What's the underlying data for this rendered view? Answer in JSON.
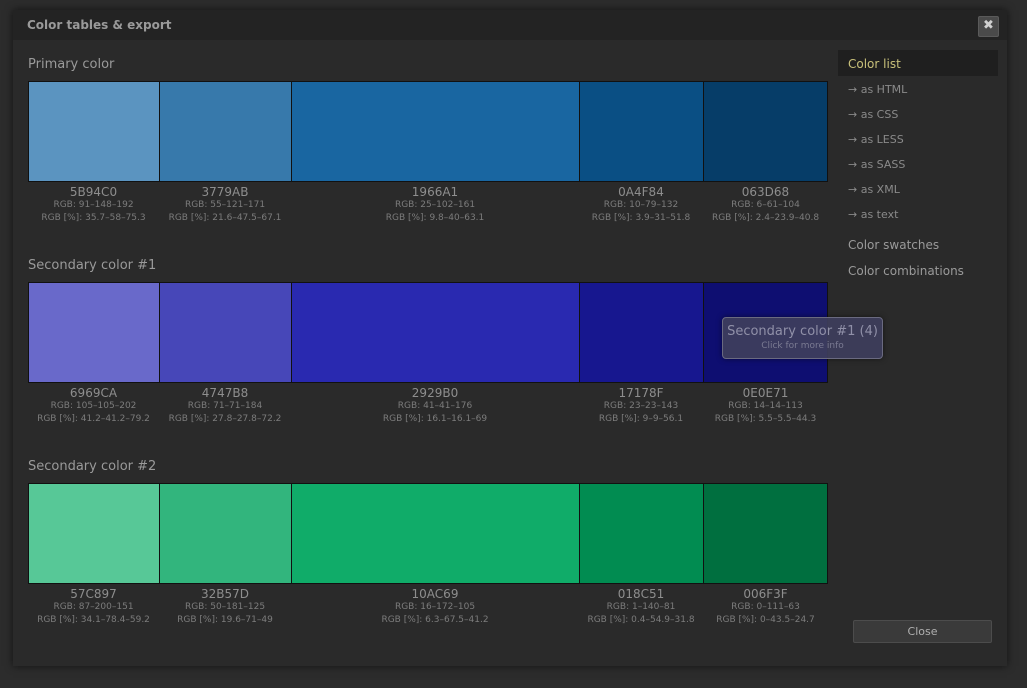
{
  "dialog": {
    "title": "Color tables & export",
    "close_glyph": "✖"
  },
  "sidebar": {
    "items": [
      {
        "label": "Color list",
        "kind": "main",
        "active": true
      },
      {
        "label": "→  as HTML",
        "kind": "sub"
      },
      {
        "label": "→  as CSS",
        "kind": "sub"
      },
      {
        "label": "→  as LESS",
        "kind": "sub"
      },
      {
        "label": "→  as SASS",
        "kind": "sub"
      },
      {
        "label": "→  as XML",
        "kind": "sub"
      },
      {
        "label": "→  as text",
        "kind": "sub"
      },
      {
        "label": "Color swatches",
        "kind": "main"
      },
      {
        "label": "Color combinations",
        "kind": "main"
      }
    ]
  },
  "close_button": "Close",
  "tooltip": {
    "title": "Secondary color #1 (4)",
    "subtitle": "Click for more info"
  },
  "groups": [
    {
      "name": "Primary color",
      "swatches": [
        {
          "hex": "5B94C0",
          "color": "#5B94C0",
          "rgb": "RGB: 91–148–192",
          "pct": "RGB [%]: 35.7–58–75.3"
        },
        {
          "hex": "3779AB",
          "color": "#3779AB",
          "rgb": "RGB: 55–121–171",
          "pct": "RGB [%]: 21.6–47.5–67.1"
        },
        {
          "hex": "1966A1",
          "color": "#1966A1",
          "rgb": "RGB: 25–102–161",
          "pct": "RGB [%]: 9.8–40–63.1"
        },
        {
          "hex": "0A4F84",
          "color": "#0A4F84",
          "rgb": "RGB: 10–79–132",
          "pct": "RGB [%]: 3.9–31–51.8"
        },
        {
          "hex": "063D68",
          "color": "#063D68",
          "rgb": "RGB: 6–61–104",
          "pct": "RGB [%]: 2.4–23.9–40.8"
        }
      ]
    },
    {
      "name": "Secondary color #1",
      "swatches": [
        {
          "hex": "6969CA",
          "color": "#6969CA",
          "rgb": "RGB: 105–105–202",
          "pct": "RGB [%]: 41.2–41.2–79.2"
        },
        {
          "hex": "4747B8",
          "color": "#4747B8",
          "rgb": "RGB: 71–71–184",
          "pct": "RGB [%]: 27.8–27.8–72.2"
        },
        {
          "hex": "2929B0",
          "color": "#2929B0",
          "rgb": "RGB: 41–41–176",
          "pct": "RGB [%]: 16.1–16.1–69"
        },
        {
          "hex": "17178F",
          "color": "#17178F",
          "rgb": "RGB: 23–23–143",
          "pct": "RGB [%]: 9–9–56.1"
        },
        {
          "hex": "0E0E71",
          "color": "#0E0E71",
          "rgb": "RGB: 14–14–113",
          "pct": "RGB [%]: 5.5–5.5–44.3"
        }
      ]
    },
    {
      "name": "Secondary color #2",
      "swatches": [
        {
          "hex": "57C897",
          "color": "#57C897",
          "rgb": "RGB: 87–200–151",
          "pct": "RGB [%]: 34.1–78.4–59.2"
        },
        {
          "hex": "32B57D",
          "color": "#32B57D",
          "rgb": "RGB: 50–181–125",
          "pct": "RGB [%]: 19.6–71–49"
        },
        {
          "hex": "10AC69",
          "color": "#10AC69",
          "rgb": "RGB: 16–172–105",
          "pct": "RGB [%]: 6.3–67.5–41.2"
        },
        {
          "hex": "018C51",
          "color": "#018C51",
          "rgb": "RGB: 1–140–81",
          "pct": "RGB [%]: 0.4–54.9–31.8"
        },
        {
          "hex": "006F3F",
          "color": "#006F3F",
          "rgb": "RGB: 0–111–63",
          "pct": "RGB [%]: 0–43.5–24.7"
        }
      ]
    }
  ]
}
